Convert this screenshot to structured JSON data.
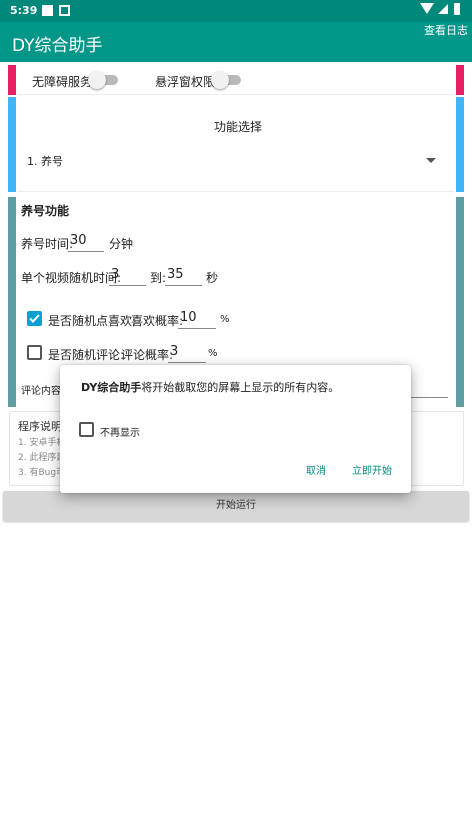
{
  "status_bar": {
    "time": "5:39"
  },
  "app_bar": {
    "title": "DY综合助手",
    "action": "查看日志"
  },
  "permissions": {
    "accessibility_label": "无障碍服务",
    "overlay_label": "悬浮窗权限"
  },
  "function_select": {
    "title": "功能选择",
    "selected": "1. 养号"
  },
  "nurture": {
    "title": "养号功能",
    "time_label": "养号时间:",
    "time_value": "30",
    "time_unit": "分钟",
    "video_label": "单个视频随机时间:",
    "video_min": "3",
    "video_to": "到:",
    "video_max": "35",
    "video_unit": "秒",
    "like_label": "是否随机点喜欢:",
    "like_checked": true,
    "like_rate_label": "喜欢概率:",
    "like_rate_value": "10",
    "like_rate_unit": "%",
    "comment_label": "是否随机评论:",
    "comment_checked": false,
    "comment_rate_label": "评论概率:",
    "comment_rate_value": "3",
    "comment_rate_unit": "%",
    "comment_content_label": "评论内容"
  },
  "notes": {
    "title": "程序说明",
    "lines": [
      "1. 安卓手机",
      "2. 此程序建",
      "3. 有Bug可"
    ]
  },
  "start_button": "开始运行",
  "dialog": {
    "message_bold": "DY综合助手",
    "message_rest": "将开始截取您的屏幕上显示的所有内容。",
    "dont_show": "不再显示",
    "cancel": "取消",
    "start_now": "立即开始"
  },
  "colors": {
    "primary": "#009688",
    "primary_dark": "#00897b",
    "pink": "#e91e63",
    "blue": "#42b3f5",
    "teal_bar": "#5f9ea0",
    "checkbox": "#0a9fd6"
  }
}
